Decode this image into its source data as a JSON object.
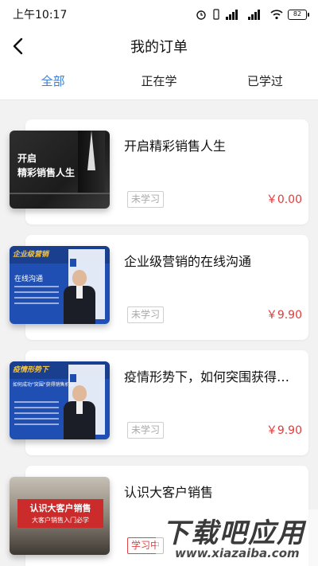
{
  "status_bar": {
    "time": "上午10:17",
    "battery": "82",
    "network_1": "4G",
    "network_2": "HD"
  },
  "header": {
    "title": "我的订单"
  },
  "tabs": [
    {
      "label": "全部",
      "active": true
    },
    {
      "label": "正在学",
      "active": false
    },
    {
      "label": "已学过",
      "active": false
    }
  ],
  "orders": [
    {
      "title": "开启精彩销售人生",
      "status": "未学习",
      "price": "￥0.00",
      "thumb_text": [
        "开启",
        "精彩销售人生"
      ]
    },
    {
      "title": "企业级营销的在线沟通",
      "status": "未学习",
      "price": "￥9.90",
      "thumb_text": [
        "企业级营销",
        "在线沟通"
      ]
    },
    {
      "title": "疫情形势下，如何突围获得销售业绩",
      "status": "未学习",
      "price": "￥9.90",
      "thumb_text": [
        "疫情形势下",
        "如何成功\"突围\"获得销售机会"
      ]
    },
    {
      "title": "认识大客户销售",
      "status": "学习中",
      "price": "",
      "thumb_text": [
        "认识大客户销售",
        "大客户销售入门必学"
      ]
    }
  ],
  "watermark": {
    "main": "下载吧应用",
    "url": "www.xiazaiba.com"
  },
  "colors": {
    "accent": "#3b7dd8",
    "price": "#e03b3b",
    "background": "#f2f2f2"
  }
}
